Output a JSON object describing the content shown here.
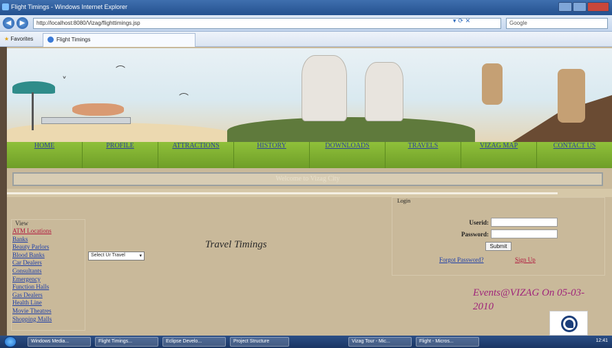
{
  "window": {
    "title": "Flight Timings - Windows Internet Explorer"
  },
  "browser": {
    "address": "http://localhost:8080/Vizag/flighttimings.jsp",
    "search_placeholder": "Google",
    "favorites_label": "Favorites",
    "tab_title": "Flight Timings"
  },
  "site": {
    "menu": [
      {
        "label": "HOME"
      },
      {
        "label": "PROFILE"
      },
      {
        "label": "ATTRACTIONS"
      },
      {
        "label": "HISTORY"
      },
      {
        "label": "DOWNLOADS"
      },
      {
        "label": "TRAVELS"
      },
      {
        "label": "VIZAG MAP"
      },
      {
        "label": "CONTACT US"
      }
    ],
    "welcome": "Welcome to Vizag City"
  },
  "sidebar": {
    "title": "View",
    "items": [
      {
        "label": "ATM Locations"
      },
      {
        "label": "Banks"
      },
      {
        "label": "Beauty Parlors"
      },
      {
        "label": "Blood Banks"
      },
      {
        "label": "Car Dealers"
      },
      {
        "label": "Consultants"
      },
      {
        "label": "Emergency"
      },
      {
        "label": "Function Halls"
      },
      {
        "label": "Gas Dealers"
      },
      {
        "label": "Health Line"
      },
      {
        "label": "Movie Theatres"
      },
      {
        "label": "Shopping Malls"
      }
    ]
  },
  "main": {
    "select_value": "Select Ur Travel",
    "title": "Travel Timings"
  },
  "login": {
    "title": "Login",
    "userid_label": "Userid:",
    "password_label": "Password:",
    "submit_label": "Submit",
    "forgot_label": "Forgot Password?",
    "signup_label": "Sign Up"
  },
  "events": {
    "text": "Events@VIZAG On 05-03-2010"
  },
  "taskbar": {
    "tasks": [
      {
        "label": "Windows Media..."
      },
      {
        "label": "Flight Timings..."
      },
      {
        "label": "Eclipse Develo..."
      },
      {
        "label": "Project Structure"
      },
      {
        "label": "Vizag Tour - Mic..."
      },
      {
        "label": "Flight - Micros..."
      }
    ],
    "clock": "12:41"
  }
}
